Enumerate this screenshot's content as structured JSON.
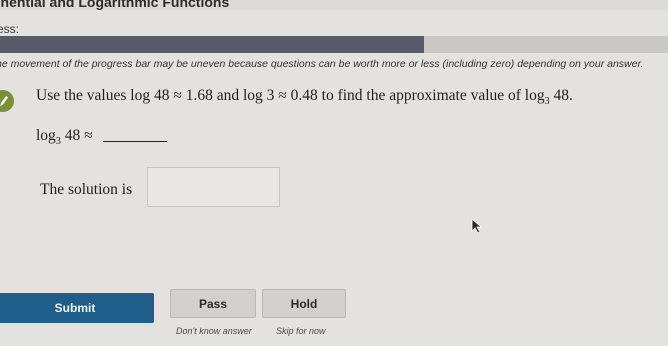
{
  "header": {
    "title": "onential and Logarithmic Functions"
  },
  "progress": {
    "label": "ess:",
    "fraction": 0.635,
    "note": "he movement of the progress bar may be uneven because questions can be worth more or less (including zero) depending on your answer."
  },
  "question": {
    "icon": "pencil-icon",
    "text_pre": "Use the values log 48 ≈ 1.68 and log 3 ≈ 0.48 to find the approximate value of log",
    "base": "3",
    "text_post": " 48.",
    "answer_prefix": "log",
    "answer_base": "3",
    "answer_suffix": " 48 ≈",
    "solution_label": "The solution is",
    "answer_value": ""
  },
  "buttons": {
    "submit": "Submit",
    "pass": "Pass",
    "hold": "Hold",
    "pass_sub": "Don't know answer",
    "hold_sub": "Skip for now"
  },
  "colors": {
    "submit_bg": "#1f5e8a",
    "progress_fill": "#575b67",
    "icon_bg": "#7a8f3a"
  }
}
